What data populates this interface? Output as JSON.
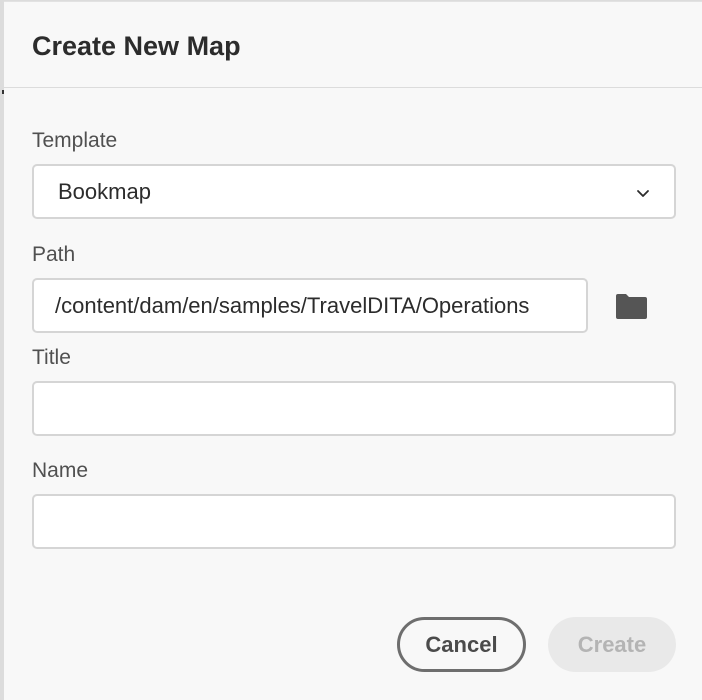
{
  "dialog": {
    "title": "Create New Map"
  },
  "form": {
    "template": {
      "label": "Template",
      "selected": "Bookmap"
    },
    "path": {
      "label": "Path",
      "value": "/content/dam/en/samples/TravelDITA/Operations"
    },
    "title": {
      "label": "Title",
      "value": ""
    },
    "name": {
      "label": "Name",
      "value": ""
    }
  },
  "buttons": {
    "cancel_label": "Cancel",
    "create_label": "Create"
  },
  "icons": {
    "template_dropdown": "chevron-down-icon",
    "path_browse": "folder-icon"
  },
  "colors": {
    "dialog_background": "#f8f8f8",
    "title_text": "#2c2c2c",
    "label_text": "#505050",
    "field_border": "#d5d5d5",
    "cancel_border": "#6e6e6e",
    "create_disabled_bg": "#e9e9e9",
    "create_disabled_text": "#b4b4b4",
    "folder_icon": "#555555"
  }
}
